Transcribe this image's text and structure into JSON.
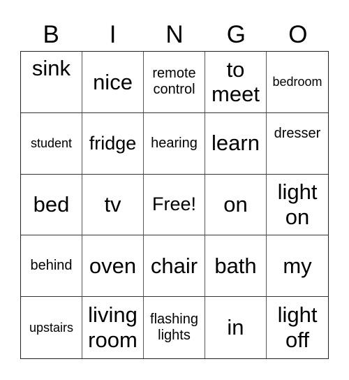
{
  "header": {
    "letters": [
      "B",
      "I",
      "N",
      "G",
      "O"
    ]
  },
  "board": {
    "rows": [
      [
        "sink",
        "nice",
        "remote control",
        "to meet",
        "bedroom"
      ],
      [
        "student",
        "fridge",
        "hearing",
        "learn",
        "dresser"
      ],
      [
        "bed",
        "tv",
        "Free!",
        "on",
        "light on"
      ],
      [
        "behind",
        "oven",
        "chair",
        "bath",
        "my"
      ],
      [
        "upstairs",
        "living room",
        "flashing lights",
        "in",
        "light off"
      ]
    ]
  }
}
